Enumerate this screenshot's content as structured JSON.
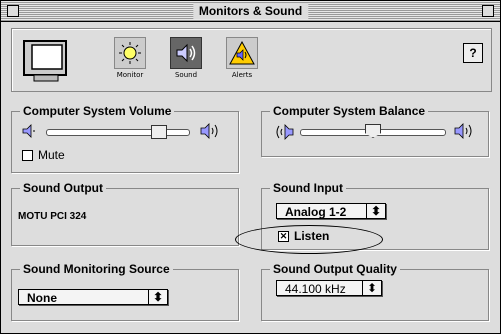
{
  "window": {
    "title": "Monitors & Sound"
  },
  "toolbar": {
    "buttons": [
      {
        "label": "Monitor",
        "icon": "sun-icon"
      },
      {
        "label": "Sound",
        "icon": "speaker-icon"
      },
      {
        "label": "Alerts",
        "icon": "alert-icon"
      }
    ],
    "help_label": "?"
  },
  "volume": {
    "title": "Computer System Volume",
    "level_fraction": 0.82,
    "mute_label": "Mute",
    "mute_checked": false
  },
  "balance": {
    "title": "Computer System Balance",
    "position_fraction": 0.5
  },
  "sound_output": {
    "title": "Sound Output",
    "device": "MOTU PCI 324"
  },
  "sound_input": {
    "title": "Sound Input",
    "selected": "Analog 1-2",
    "listen_label": "Listen",
    "listen_checked": true
  },
  "monitoring_source": {
    "title": "Sound Monitoring Source",
    "selected": "None"
  },
  "output_quality": {
    "title": "Sound Output Quality",
    "selected": "44.100 kHz"
  },
  "icons": {
    "popup_arrow": "⬍",
    "checked_mark": "✕"
  }
}
